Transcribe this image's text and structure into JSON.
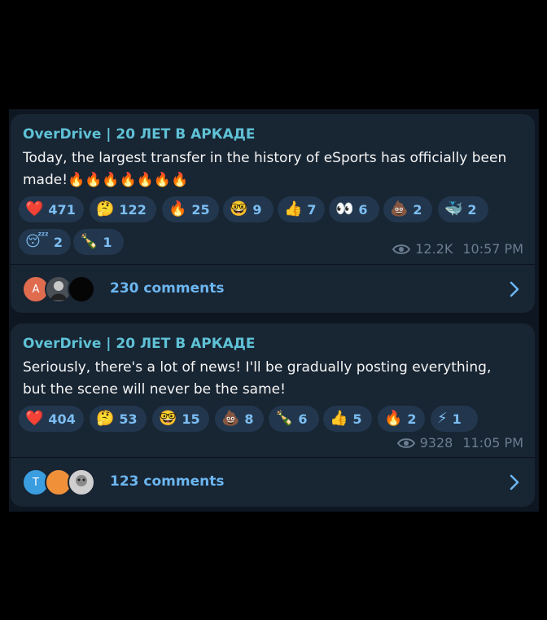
{
  "messages": [
    {
      "author": "OverDrive | 20 ЛЕТ В АРКАДЕ",
      "text": "Today, the largest transfer in the history of eSports has officially been made!🔥🔥🔥🔥🔥🔥🔥",
      "reactions": [
        {
          "emoji": "❤️",
          "icon": "heart-icon",
          "count": "471"
        },
        {
          "emoji": "🤔",
          "icon": "thinking-face-icon",
          "count": "122"
        },
        {
          "emoji": "🔥",
          "icon": "fire-icon",
          "count": "25"
        },
        {
          "emoji": "🤓",
          "icon": "nerd-face-icon",
          "count": "9"
        },
        {
          "emoji": "👍",
          "icon": "thumbs-up-icon",
          "count": "7"
        },
        {
          "emoji": "👀",
          "icon": "eyes-icon",
          "count": "6"
        },
        {
          "emoji": "💩",
          "icon": "poop-icon",
          "count": "2"
        },
        {
          "emoji": "🐳",
          "icon": "whale-icon",
          "count": "2"
        },
        {
          "emoji": "😴",
          "icon": "sleeping-face-icon",
          "count": "2"
        },
        {
          "emoji": "🍾",
          "icon": "champagne-icon",
          "count": "1"
        }
      ],
      "views": "12.2K",
      "time": "10:57 PM",
      "comments_label": "230 comments",
      "avatars": [
        {
          "letter": "A",
          "color": "#e06c4f",
          "icon": "avatar-letter-a"
        },
        {
          "letter": "",
          "color": "#4a4f56",
          "icon": "avatar-photo"
        },
        {
          "letter": "",
          "color": "#050505",
          "icon": "avatar-dark"
        }
      ]
    },
    {
      "author": "OverDrive | 20 ЛЕТ В АРКАДЕ",
      "text": "Seriously, there's a lot of news! I'll be gradually posting everything, but the scene will never be the same!",
      "reactions": [
        {
          "emoji": "❤️",
          "icon": "heart-icon",
          "count": "404"
        },
        {
          "emoji": "🤔",
          "icon": "thinking-face-icon",
          "count": "53"
        },
        {
          "emoji": "🤓",
          "icon": "nerd-face-icon",
          "count": "15"
        },
        {
          "emoji": "💩",
          "icon": "poop-icon",
          "count": "8"
        },
        {
          "emoji": "🍾",
          "icon": "champagne-icon",
          "count": "6"
        },
        {
          "emoji": "👍",
          "icon": "thumbs-up-icon",
          "count": "5"
        },
        {
          "emoji": "🔥",
          "icon": "fire-icon",
          "count": "2"
        },
        {
          "emoji": "⚡",
          "icon": "lightning-icon",
          "count": "1"
        }
      ],
      "views": "9328",
      "time": "11:05 PM",
      "comments_label": "123 comments",
      "avatars": [
        {
          "letter": "T",
          "color": "#3a9de0",
          "icon": "avatar-letter-t"
        },
        {
          "letter": "",
          "color": "#f0913a",
          "icon": "avatar-orange"
        },
        {
          "letter": "",
          "color": "#cfcfcf",
          "icon": "avatar-photo"
        }
      ]
    }
  ]
}
